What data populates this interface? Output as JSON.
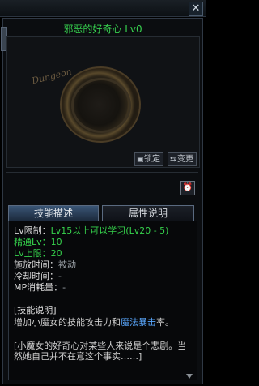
{
  "window": {
    "close_label": "✕"
  },
  "skill": {
    "name": "邪恶的好奇心 Lv0"
  },
  "preview": {
    "emblem_text": "Dungeon"
  },
  "buttons": {
    "lock": "锁定",
    "change": "变更",
    "timer_icon": "⏰"
  },
  "tabs": [
    {
      "label": "技能描述",
      "active": true
    },
    {
      "label": "属性说明",
      "active": false
    }
  ],
  "details": {
    "lv_limit_label": "Lv限制：",
    "lv_limit_value": "Lv15以上可以学习(Lv20 - 5)",
    "mastery_label": "精通Lv：",
    "mastery_value": "10",
    "max_label": "Lv上限：",
    "max_value": "20",
    "cast_label": "施放时间：",
    "cast_value": "被动",
    "cooldown_label": "冷却时间：",
    "cooldown_value": "-",
    "mp_label": "MP消耗量：",
    "mp_value": "-"
  },
  "description": {
    "header": "[技能说明]",
    "line1_a": "    增加小魔女的技能攻击力和",
    "line1_b": "魔法暴击",
    "line1_c": "率。",
    "line2": "    [小魔女的好奇心对某些人来说是个悲剧。当然她自己并不在意这个事实……]"
  },
  "colors": {
    "green": "#36d24c",
    "blue": "#5aa8ff"
  }
}
